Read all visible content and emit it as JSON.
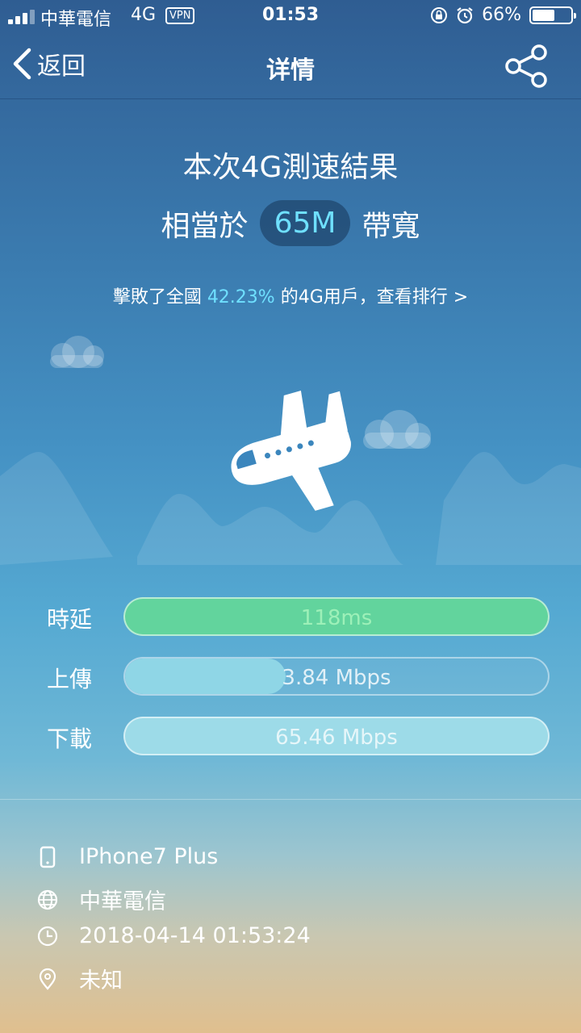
{
  "status_bar": {
    "carrier": "中華電信",
    "network": "4G",
    "vpn": "VPN",
    "time": "01:53",
    "battery": "66%",
    "battery_level": 0.66
  },
  "nav": {
    "back_label": "返回",
    "title": "详情"
  },
  "result": {
    "title": "本次4G測速結果",
    "prefix": "相當於",
    "bandwidth": "65M",
    "suffix": "帶寬",
    "rank_before": "擊敗了全國 ",
    "rank_percent": "42.23%",
    "rank_after": " 的4G用戶，查看排行 >"
  },
  "metrics": [
    {
      "label": "時延",
      "value": "118ms",
      "level": 1.0
    },
    {
      "label": "上傳",
      "value": "3.84 Mbps",
      "level": 0.38
    },
    {
      "label": "下載",
      "value": "65.46 Mbps",
      "level": 1.0
    }
  ],
  "info": {
    "device": "IPhone7 Plus",
    "carrier": "中華電信",
    "datetime": "2018-04-14 01:53:24",
    "location": "未知"
  },
  "icons": {
    "back": "chevron-left-icon",
    "share": "share-icon",
    "device": "phone-icon",
    "carrier": "globe-icon",
    "datetime": "clock-icon",
    "location": "location-pin-icon"
  },
  "colors": {
    "accent": "#6fe0ff",
    "latency_bar": "#62d49d",
    "upload_bar": "#8fd6e6",
    "download_bar": "#9ddbe8"
  }
}
